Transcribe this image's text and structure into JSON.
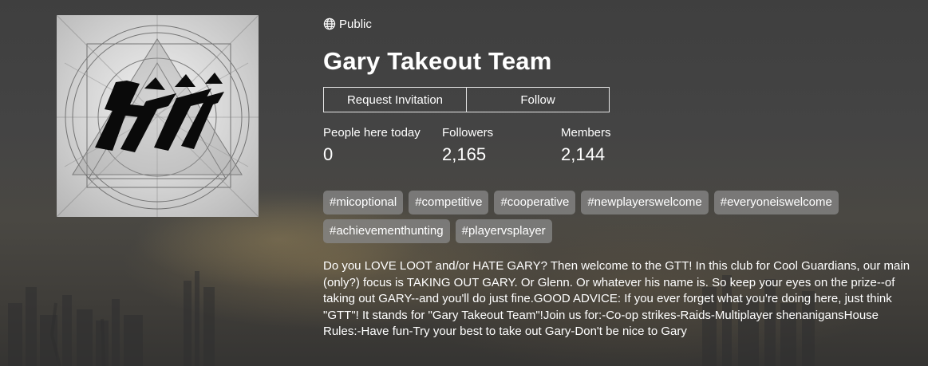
{
  "club": {
    "privacy_label": "Public",
    "name": "Gary Takeout Team",
    "logo_text": "GTT"
  },
  "actions": {
    "request_label": "Request Invitation",
    "follow_label": "Follow"
  },
  "stats": [
    {
      "label": "People here today",
      "value": "0"
    },
    {
      "label": "Followers",
      "value": "2,165"
    },
    {
      "label": "Members",
      "value": "2,144"
    }
  ],
  "tags": [
    "#micoptional",
    "#competitive",
    "#cooperative",
    "#newplayerswelcome",
    "#everyoneiswelcome",
    "#achievementhunting",
    "#playervsplayer"
  ],
  "description": "Do you LOVE LOOT and/or HATE GARY? Then welcome to the GTT! In this club for Cool Guardians, our main (only?) focus is TAKING OUT GARY. Or Glenn. Or whatever his name is. So keep your eyes on the prize--of taking out GARY--and you'll do just fine.GOOD ADVICE: If you ever forget what you're doing here, just think \"GTT\"! It stands for \"Gary Takeout Team\"!Join us for:-Co-op strikes-Raids-Multiplayer shenanigansHouse Rules:-Have fun-Try your best to take out Gary-Don't be nice to Gary",
  "colors": {
    "background": "#434343",
    "tag_background": "#878787",
    "text": "#ffffff"
  },
  "icons": {
    "privacy": "globe-icon"
  }
}
